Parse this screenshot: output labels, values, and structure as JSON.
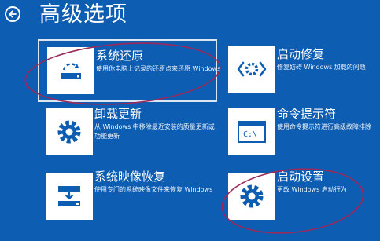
{
  "colors": {
    "background": "#0d5db3",
    "tile": "#ffffff",
    "icon": "#0d5db3",
    "annotation": "#9b2a5a"
  },
  "header": {
    "back_icon": "arrow-left-icon",
    "title": "高级选项"
  },
  "options": [
    {
      "title": "系统还原",
      "description": "使用你电脑上记录的还原点来还原 Windows",
      "icon": "restore-icon",
      "selected": true
    },
    {
      "title": "启动修复",
      "description": "修复妨碍 Windows 加载的问题",
      "icon": "repair-icon",
      "selected": false
    },
    {
      "title": "卸载更新",
      "description": "从 Windows 中移除最近安装的质量更新或功能更新",
      "icon": "gear-icon",
      "selected": false
    },
    {
      "title": "命令提示符",
      "description": "使用命令提示符进行高级故障排除",
      "icon": "command-prompt-icon",
      "selected": false
    },
    {
      "title": "系统映像恢复",
      "description": "使用专门的系统映像文件来恢复 Windows",
      "icon": "image-recovery-icon",
      "selected": false
    },
    {
      "title": "启动设置",
      "description": "更改 Windows 启动行为",
      "icon": "gear-icon",
      "selected": false
    }
  ],
  "command_prompt_tile_text": "C:\\"
}
